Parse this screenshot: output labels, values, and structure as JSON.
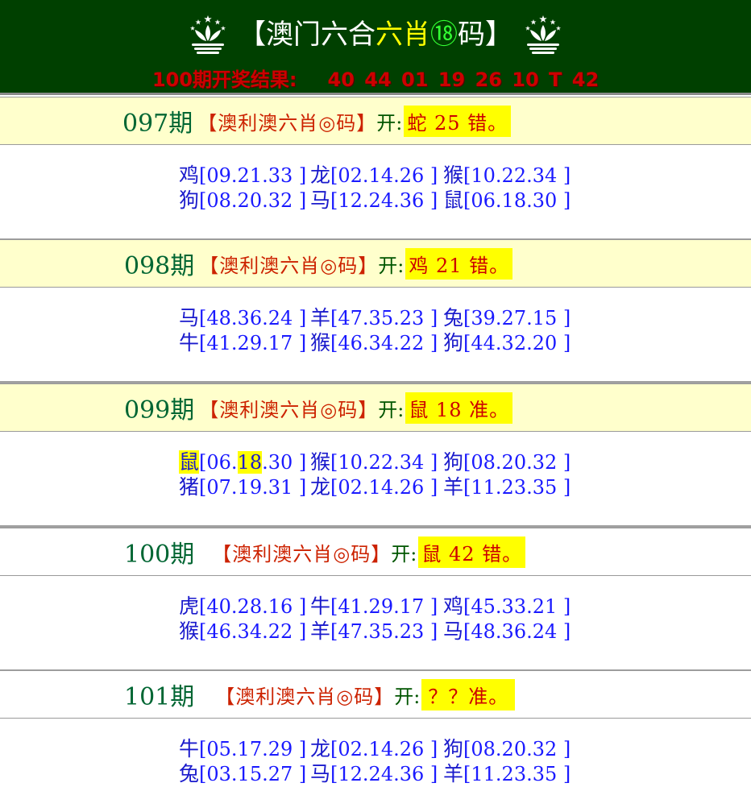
{
  "header": {
    "title_prefix": "【澳门六合",
    "title_highlight": "六肖",
    "title_num": "⑱",
    "title_suffix": "码】",
    "result_label": "100期开奖结果:",
    "result_numbers": "40 44 01 19 26 10 T 42"
  },
  "sections": [
    {
      "issue": "097期",
      "label": "【澳利澳六肖◎码】",
      "open": "开:",
      "result": "蛇 25 错。",
      "rows": [
        [
          {
            "z": "鸡",
            "n": "[09.21.33 ]"
          },
          {
            "z": "龙",
            "n": "[02.14.26 ]"
          },
          {
            "z": "猴",
            "n": "[10.22.34 ]"
          }
        ],
        [
          {
            "z": "狗",
            "n": "[08.20.32 ]"
          },
          {
            "z": "马",
            "n": "[12.24.36 ]"
          },
          {
            "z": "鼠",
            "n": "[06.18.30 ]"
          }
        ]
      ]
    },
    {
      "issue": "098期",
      "label": "【澳利澳六肖◎码】",
      "open": "开:",
      "result": "鸡 21 错。",
      "rows": [
        [
          {
            "z": "马",
            "n": "[48.36.24 ]"
          },
          {
            "z": "羊",
            "n": "[47.35.23 ]"
          },
          {
            "z": "兔",
            "n": "[39.27.15 ]"
          }
        ],
        [
          {
            "z": "牛",
            "n": "[41.29.17 ]"
          },
          {
            "z": "猴",
            "n": "[46.34.22 ]"
          },
          {
            "z": "狗",
            "n": "[44.32.20 ]"
          }
        ]
      ]
    },
    {
      "issue": "099期",
      "label": "【澳利澳六肖◎码】",
      "open": "开:",
      "result": "鼠 18 准。",
      "rows": [
        [
          {
            "z": "鼠",
            "n_a": "[06.",
            "n_hl": "18",
            "n_b": ".30 ]"
          },
          {
            "z": "猴",
            "n": "[10.22.34 ]"
          },
          {
            "z": "狗",
            "n": "[08.20.32 ]"
          }
        ],
        [
          {
            "z": "猪",
            "n": "[07.19.31 ]"
          },
          {
            "z": "龙",
            "n": "[02.14.26 ]"
          },
          {
            "z": "羊",
            "n": "[11.23.35 ]"
          }
        ]
      ]
    },
    {
      "issue": "100期",
      "label": "【澳利澳六肖◎码】",
      "open": "开:",
      "result": "鼠 42 错。",
      "rows": [
        [
          {
            "z": "虎",
            "n": "[40.28.16 ]"
          },
          {
            "z": "牛",
            "n": "[41.29.17 ]"
          },
          {
            "z": "鸡",
            "n": "[45.33.21 ]"
          }
        ],
        [
          {
            "z": "猴",
            "n": "[46.34.22 ]"
          },
          {
            "z": "羊",
            "n": "[47.35.23 ]"
          },
          {
            "z": "马",
            "n": "[48.36.24 ]"
          }
        ]
      ]
    },
    {
      "issue": "101期",
      "label": "【澳利澳六肖◎码】",
      "open": "开:",
      "result": "？？准。",
      "rows": [
        [
          {
            "z": "牛",
            "n": "[05.17.29 ]"
          },
          {
            "z": "龙",
            "n": "[02.14.26 ]"
          },
          {
            "z": "狗",
            "n": "[08.20.32 ]"
          }
        ],
        [
          {
            "z": "兔",
            "n": "[03.15.27 ]"
          },
          {
            "z": "马",
            "n": "[12.24.36 ]"
          },
          {
            "z": "羊",
            "n": "[11.23.35 ]"
          }
        ]
      ]
    }
  ],
  "colors": {
    "header_bg": "#004000",
    "issue": "#006633",
    "label": "#cc2200",
    "badge_bg": "#ffff00",
    "numbers": "#1a1aff"
  },
  "icons": {
    "emblem": "lotus-emblem-icon"
  }
}
